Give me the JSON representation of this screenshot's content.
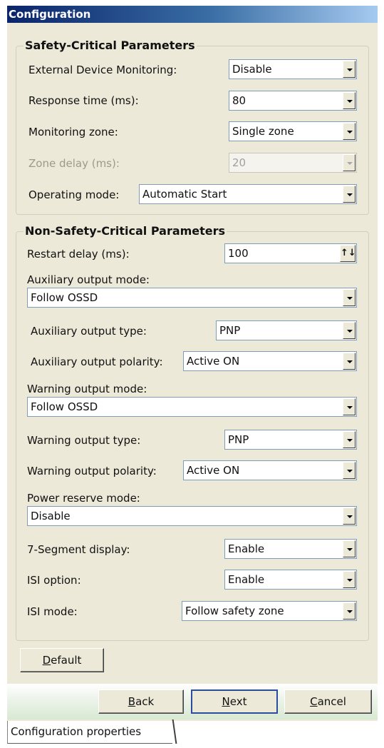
{
  "window": {
    "title": "Configuration"
  },
  "safety": {
    "title": "Safety-Critical Parameters",
    "external_device_monitoring": {
      "label": "External Device Monitoring:",
      "value": "Disable"
    },
    "response_time": {
      "label": "Response time (ms):",
      "value": "80"
    },
    "monitoring_zone": {
      "label": "Monitoring zone:",
      "value": "Single zone"
    },
    "zone_delay": {
      "label": "Zone delay (ms):",
      "value": "20"
    },
    "operating_mode": {
      "label": "Operating mode:",
      "value": "Automatic Start"
    }
  },
  "nonsafety": {
    "title": "Non-Safety-Critical Parameters",
    "restart_delay": {
      "label": "Restart delay (ms):",
      "value": "100"
    },
    "aux_output_mode": {
      "label": "Auxiliary output mode:",
      "value": "Follow OSSD"
    },
    "aux_output_type": {
      "label": "Auxiliary output type:",
      "value": "PNP"
    },
    "aux_output_polarity": {
      "label": "Auxiliary output polarity:",
      "value": "Active ON"
    },
    "warning_output_mode": {
      "label": "Warning output mode:",
      "value": "Follow OSSD"
    },
    "warning_output_type": {
      "label": "Warning output type:",
      "value": "PNP"
    },
    "warning_output_polarity": {
      "label": "Warning output polarity:",
      "value": "Active ON"
    },
    "power_reserve_mode": {
      "label": "Power reserve mode:",
      "value": "Disable"
    },
    "seven_segment": {
      "label": "7-Segment display:",
      "value": "Enable"
    },
    "isi_option": {
      "label": "ISI option:",
      "value": "Enable"
    },
    "isi_mode": {
      "label": "ISI mode:",
      "value": "Follow safety zone"
    }
  },
  "buttons": {
    "default": {
      "mnemonic": "D",
      "rest": "efault"
    },
    "back": {
      "mnemonic": "B",
      "rest": "ack"
    },
    "next": {
      "mnemonic": "N",
      "rest": "ext"
    },
    "cancel": {
      "mnemonic": "C",
      "rest": "ancel"
    }
  },
  "tabs": {
    "active": "Configuration properties"
  },
  "colors": {
    "title_bar": "#0a246a",
    "dialog_bg": "#ece9d8",
    "focus_border": "#2b4e9c"
  }
}
